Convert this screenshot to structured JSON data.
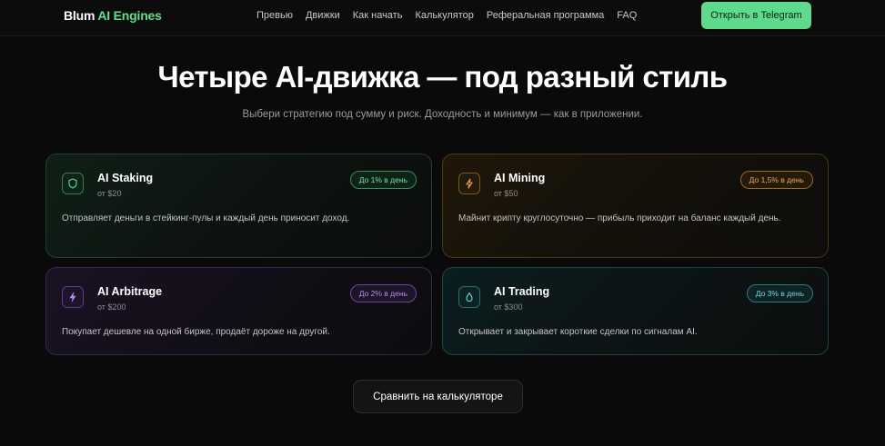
{
  "nav": {
    "logo_brand": "Blum",
    "logo_accent": "AI Engines",
    "links": [
      "Превью",
      "Движки",
      "Как начать",
      "Калькулятор",
      "Реферальная программа",
      "FAQ"
    ],
    "cta": "Открыть в Telegram"
  },
  "hero": {
    "title": "Четыре AI-движка — под разный стиль",
    "subtitle": "Выбери стратегию под сумму и риск. Доходность и минимум — как в приложении."
  },
  "engines": [
    {
      "name": "AI Staking",
      "min": "от $20",
      "badge": "До 1% в день",
      "desc": "Отправляет деньги в стейкинг-пулы и каждый день приносит доход.",
      "icon": "shield-icon",
      "color": "#5fe08f"
    },
    {
      "name": "AI Mining",
      "min": "от $50",
      "badge": "До 1,5% в день",
      "desc": "Майнит крипту круглосуточно — прибыль приходит на баланс каждый день.",
      "icon": "lightning-icon",
      "color": "#f0a94a"
    },
    {
      "name": "AI Arbitrage",
      "min": "от $200",
      "badge": "До 2% в день",
      "desc": "Покупает дешевле на одной бирже, продаёт дороже на другой.",
      "icon": "bolt-icon",
      "color": "#b58cf5"
    },
    {
      "name": "AI Trading",
      "min": "от $300",
      "badge": "До 3% в день",
      "desc": "Открывает и закрывает короткие сделки по сигналам AI.",
      "icon": "drop-icon",
      "color": "#6fd9dd"
    }
  ],
  "compare_button": "Сравнить на калькуляторе"
}
